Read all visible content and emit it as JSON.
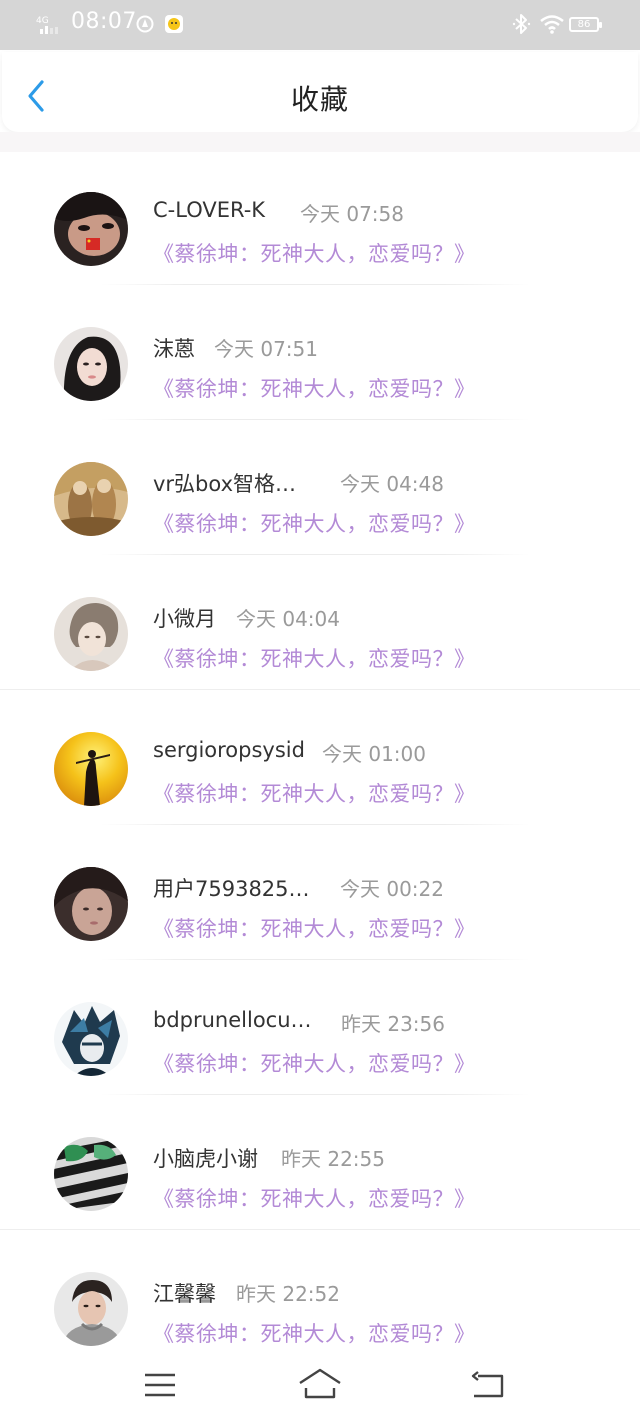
{
  "status_bar": {
    "network": "4G",
    "time": "08:07",
    "battery": "86"
  },
  "header": {
    "title": "收藏"
  },
  "items": [
    {
      "name": "C-LOVER-K",
      "time": "今天 07:58",
      "content": "《蔡徐坤：死神大人，恋爱吗？》",
      "avatar": "avatar-1"
    },
    {
      "name": "沫蒽",
      "time": "今天 07:51",
      "content": "《蔡徐坤：死神大人，恋爱吗？》",
      "avatar": "avatar-2"
    },
    {
      "name": "vr弘box智格…",
      "time": "今天 04:48",
      "content": "《蔡徐坤：死神大人，恋爱吗？》",
      "avatar": "avatar-3"
    },
    {
      "name": "小微月",
      "time": "今天 04:04",
      "content": "《蔡徐坤：死神大人，恋爱吗？》",
      "avatar": "avatar-4"
    },
    {
      "name": "sergioropsysid",
      "time": "今天 01:00",
      "content": "《蔡徐坤：死神大人，恋爱吗？》",
      "avatar": "avatar-5"
    },
    {
      "name": "用户7593825…",
      "time": "今天 00:22",
      "content": "《蔡徐坤：死神大人，恋爱吗？》",
      "avatar": "avatar-6"
    },
    {
      "name": "bdprunellocu…",
      "time": "昨天 23:56",
      "content": "《蔡徐坤：死神大人，恋爱吗？》",
      "avatar": "avatar-7"
    },
    {
      "name": "小脑虎小谢",
      "time": "昨天 22:55",
      "content": "《蔡徐坤：死神大人，恋爱吗？》",
      "avatar": "avatar-8"
    },
    {
      "name": "江馨馨",
      "time": "昨天 22:52",
      "content": "《蔡徐坤：死神大人，恋爱吗？》",
      "avatar": "avatar-9"
    }
  ],
  "bottom_nav": {
    "icons": [
      "menu-icon",
      "home-icon",
      "back-icon"
    ]
  },
  "colors": {
    "accent": "#2c9be8",
    "content_text": "#b38ad6",
    "status_bar_bg": "#d6d6d6"
  }
}
